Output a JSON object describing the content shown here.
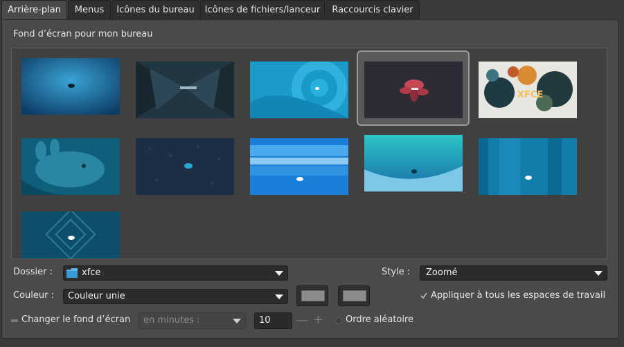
{
  "tabs": [
    {
      "label": "Arrière-plan",
      "active": true
    },
    {
      "label": "Menus",
      "active": false
    },
    {
      "label": "Icônes du bureau",
      "active": false
    },
    {
      "label": "Icônes de fichiers/lanceur",
      "active": false
    },
    {
      "label": "Raccourcis clavier",
      "active": false
    }
  ],
  "section_title": "Fond d’écran pour mon bureau",
  "wallpapers": [
    {
      "name": "wallpaper-blue-gradient",
      "selected": false
    },
    {
      "name": "wallpaper-dark-butterfly",
      "selected": false
    },
    {
      "name": "wallpaper-blue-spiral",
      "selected": false
    },
    {
      "name": "wallpaper-dark-flower",
      "selected": true
    },
    {
      "name": "wallpaper-xfce-ink",
      "selected": false,
      "text": "XFCE"
    },
    {
      "name": "wallpaper-mouse-mascot",
      "selected": false
    },
    {
      "name": "wallpaper-dark-pattern",
      "selected": false
    },
    {
      "name": "wallpaper-blue-stripes",
      "selected": false
    },
    {
      "name": "wallpaper-teal-wave",
      "selected": false
    },
    {
      "name": "wallpaper-blue-bars",
      "selected": false
    },
    {
      "name": "wallpaper-blue-squares",
      "selected": false
    }
  ],
  "folder": {
    "label": "Dossier :",
    "value": "xfce"
  },
  "style": {
    "label": "Style :",
    "value": "Zoomé"
  },
  "color": {
    "label": "Couleur :",
    "value": "Couleur unie"
  },
  "apply_all": {
    "label": "Appliquer à tous les espaces de travail",
    "checked": true
  },
  "change_bg": {
    "label": "Changer le fond d’écran",
    "checked": false
  },
  "interval": {
    "unit": "en minutes :",
    "value": "10"
  },
  "random": {
    "label": "Ordre aléatoire",
    "checked": false
  },
  "colors": {
    "accent": "#2a8fc7",
    "panel": "#4a4a4a",
    "primary_swatch": "#8c8c8c",
    "secondary_swatch": "#8c8c8c"
  }
}
